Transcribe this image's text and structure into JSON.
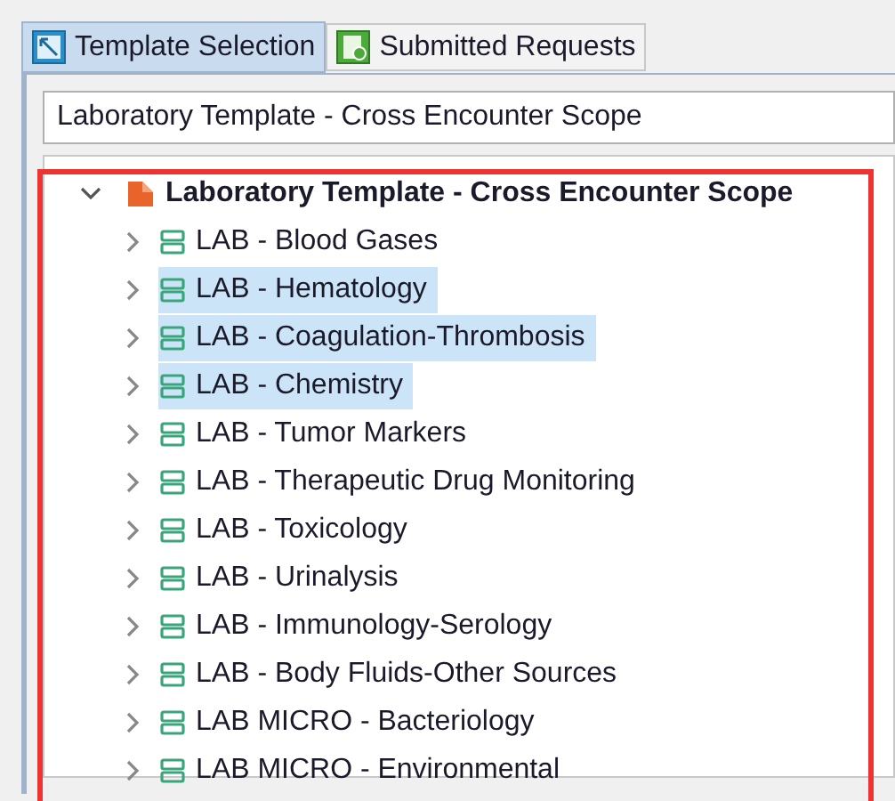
{
  "tabs": [
    {
      "label": "Template Selection",
      "selected": true,
      "kind": "template"
    },
    {
      "label": "Submitted Requests",
      "selected": false,
      "kind": "submitted"
    }
  ],
  "template_field": {
    "value": "Laboratory Template - Cross Encounter Scope"
  },
  "tree": {
    "label": "Laboratory Template - Cross Encounter Scope",
    "expanded": true,
    "children": [
      {
        "label": "LAB - Blood Gases",
        "selected": false,
        "expanded": false
      },
      {
        "label": "LAB - Hematology",
        "selected": true,
        "expanded": false
      },
      {
        "label": "LAB - Coagulation-Thrombosis",
        "selected": true,
        "expanded": false
      },
      {
        "label": "LAB - Chemistry",
        "selected": true,
        "expanded": false
      },
      {
        "label": "LAB - Tumor Markers",
        "selected": false,
        "expanded": false
      },
      {
        "label": "LAB - Therapeutic Drug Monitoring",
        "selected": false,
        "expanded": false
      },
      {
        "label": "LAB - Toxicology",
        "selected": false,
        "expanded": false
      },
      {
        "label": "LAB - Urinalysis",
        "selected": false,
        "expanded": false
      },
      {
        "label": "LAB - Immunology-Serology",
        "selected": false,
        "expanded": false
      },
      {
        "label": "LAB - Body Fluids-Other Sources",
        "selected": false,
        "expanded": false
      },
      {
        "label": "LAB MICRO - Bacteriology",
        "selected": false,
        "expanded": false
      },
      {
        "label": "LAB MICRO - Environmental",
        "selected": false,
        "expanded": false
      }
    ]
  }
}
